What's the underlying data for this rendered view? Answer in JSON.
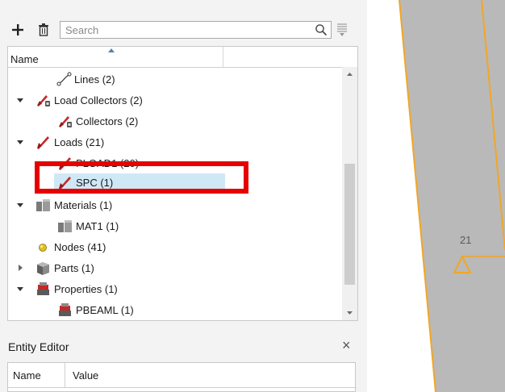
{
  "toolbar": {
    "search_placeholder": "Search",
    "add_icon": "plus-icon",
    "delete_icon": "trash-icon",
    "filter_icon": "filter-list-icon"
  },
  "tree": {
    "column_header": "Name",
    "items": [
      {
        "label": "Lines  (2)",
        "icon": "line-icon",
        "level": 1,
        "expanded": null
      },
      {
        "label": "Load Collectors  (2)",
        "icon": "load-collector-icon",
        "level": 0,
        "expanded": true
      },
      {
        "label": "Collectors  (2)",
        "icon": "load-collector-icon",
        "level": 1,
        "expanded": null
      },
      {
        "label": "Loads  (21)",
        "icon": "load-icon",
        "level": 0,
        "expanded": true
      },
      {
        "label": "PLOAD1  (20)",
        "icon": "load-icon",
        "level": 1,
        "expanded": null
      },
      {
        "label": "SPC  (1)",
        "icon": "load-icon",
        "level": 1,
        "expanded": null,
        "selected": true
      },
      {
        "label": "Materials  (1)",
        "icon": "material-icon",
        "level": 0,
        "expanded": true
      },
      {
        "label": "MAT1  (1)",
        "icon": "material-icon",
        "level": 1,
        "expanded": null
      },
      {
        "label": "Nodes  (41)",
        "icon": "node-icon",
        "level": 0,
        "expanded": null
      },
      {
        "label": "Parts  (1)",
        "icon": "part-icon",
        "level": 0,
        "expanded": false
      },
      {
        "label": "Properties  (1)",
        "icon": "property-icon",
        "level": 0,
        "expanded": true
      },
      {
        "label": "PBEAML  (1)",
        "icon": "property-icon",
        "level": 1,
        "expanded": null
      }
    ]
  },
  "entity_editor": {
    "title": "Entity Editor",
    "columns": [
      "Name",
      "Value"
    ]
  },
  "graphics": {
    "node_label": "21"
  },
  "colors": {
    "highlight": "#e60000",
    "selection": "#cfe8f6",
    "model_gray": "#b9b9b9",
    "beam_orange": "#f2a626"
  }
}
